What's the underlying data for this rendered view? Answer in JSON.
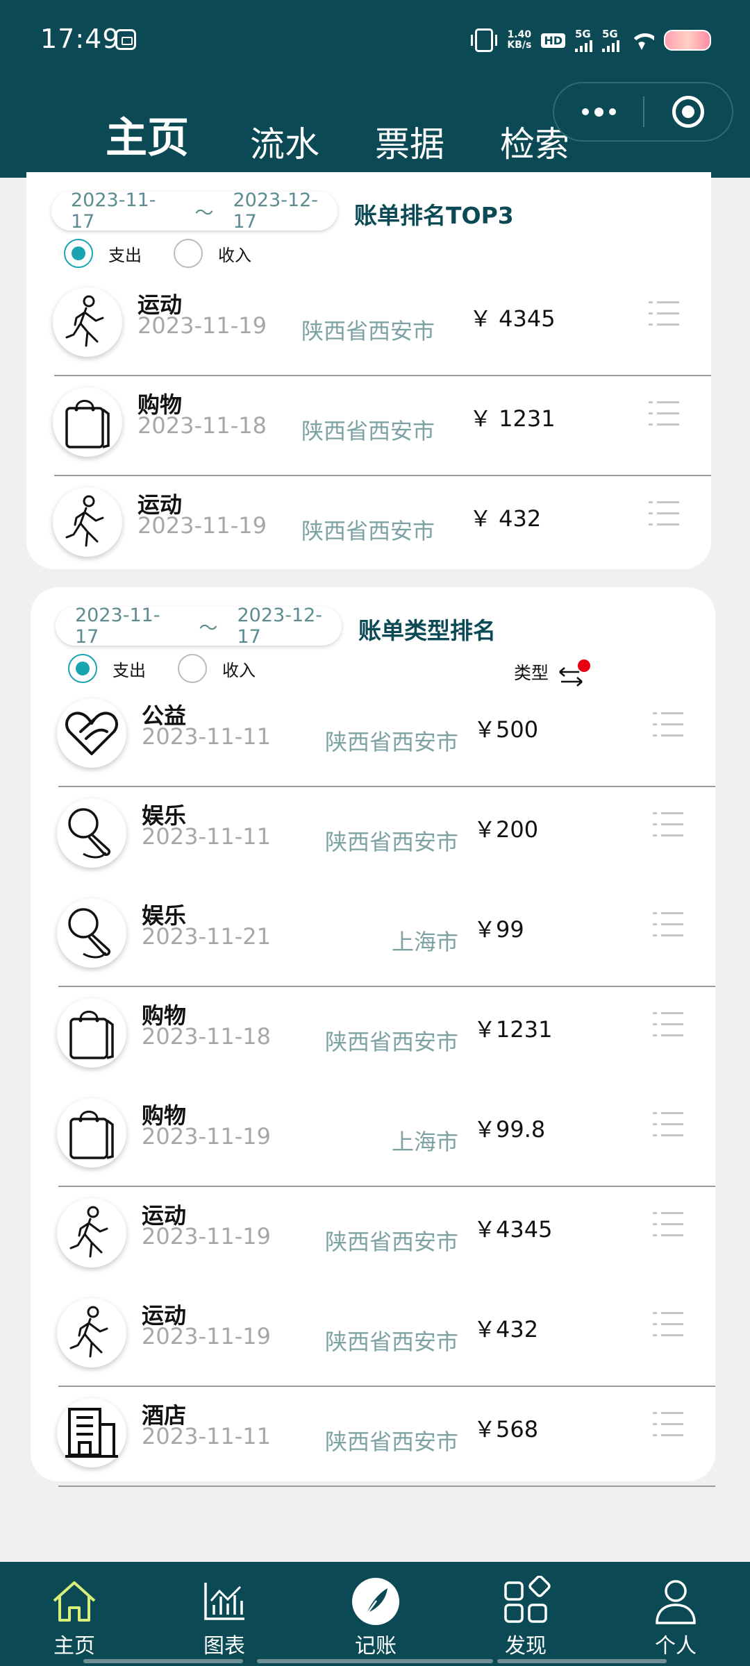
{
  "status_bar": {
    "time": "17:49",
    "speed_value": "1.40",
    "speed_unit": "KB/s",
    "hd": "HD",
    "sim1": "5G",
    "sim2": "5G"
  },
  "top_nav": {
    "tabs": [
      "主页",
      "流水",
      "票据",
      "检索"
    ],
    "active_index": 0
  },
  "top3_card": {
    "date_start": "2023-11-17",
    "date_sep": "～",
    "date_end": "2023-12-17",
    "title": "账单排名TOP3",
    "radio_expense": "支出",
    "radio_income": "收入",
    "selected": "expense",
    "rows": [
      {
        "category": "运动",
        "date": "2023-11-19",
        "location": "陕西省西安市",
        "amount": "￥ 4345",
        "icon": "running-person-icon"
      },
      {
        "category": "购物",
        "date": "2023-11-18",
        "location": "陕西省西安市",
        "amount": "￥ 1231",
        "icon": "shopping-bag-icon"
      },
      {
        "category": "运动",
        "date": "2023-11-19",
        "location": "陕西省西安市",
        "amount": "￥ 432",
        "icon": "running-person-icon"
      }
    ]
  },
  "type_card": {
    "date_start": "2023-11-17",
    "date_sep": "～",
    "date_end": "2023-12-17",
    "title": "账单类型排名",
    "radio_expense": "支出",
    "radio_income": "收入",
    "selected": "expense",
    "sort_label": "类型",
    "rows": [
      {
        "category": "公益",
        "date": "2023-11-11",
        "location": "陕西省西安市",
        "amount": "￥500",
        "icon": "charity-heart-icon"
      },
      {
        "category": "娱乐",
        "date": "2023-11-11",
        "location": "陕西省西安市",
        "amount": "￥200",
        "icon": "microphone-icon"
      },
      {
        "category": "娱乐",
        "date": "2023-11-21",
        "location": "上海市",
        "amount": "￥99",
        "icon": "microphone-icon"
      },
      {
        "category": "购物",
        "date": "2023-11-18",
        "location": "陕西省西安市",
        "amount": "￥1231",
        "icon": "shopping-bag-icon"
      },
      {
        "category": "购物",
        "date": "2023-11-19",
        "location": "上海市",
        "amount": "￥99.8",
        "icon": "shopping-bag-icon"
      },
      {
        "category": "运动",
        "date": "2023-11-19",
        "location": "陕西省西安市",
        "amount": "￥4345",
        "icon": "running-person-icon"
      },
      {
        "category": "运动",
        "date": "2023-11-19",
        "location": "陕西省西安市",
        "amount": "￥432",
        "icon": "running-person-icon"
      },
      {
        "category": "酒店",
        "date": "2023-11-11",
        "location": "陕西省西安市",
        "amount": "￥568",
        "icon": "hotel-building-icon"
      }
    ]
  },
  "bottom_tabs": [
    {
      "label": "主页",
      "icon": "home-icon",
      "active": true
    },
    {
      "label": "图表",
      "icon": "chart-icon",
      "active": false
    },
    {
      "label": "记账",
      "icon": "feather-pen-icon",
      "active": false
    },
    {
      "label": "发现",
      "icon": "discover-grid-icon",
      "active": false
    },
    {
      "label": "个人",
      "icon": "person-icon",
      "active": false
    }
  ],
  "colors": {
    "brand": "#0b4a55",
    "accent": "#1aa3b0",
    "location_text": "#7ea2a4",
    "home_active": "#d8f07a",
    "notify_dot": "#e60012"
  }
}
